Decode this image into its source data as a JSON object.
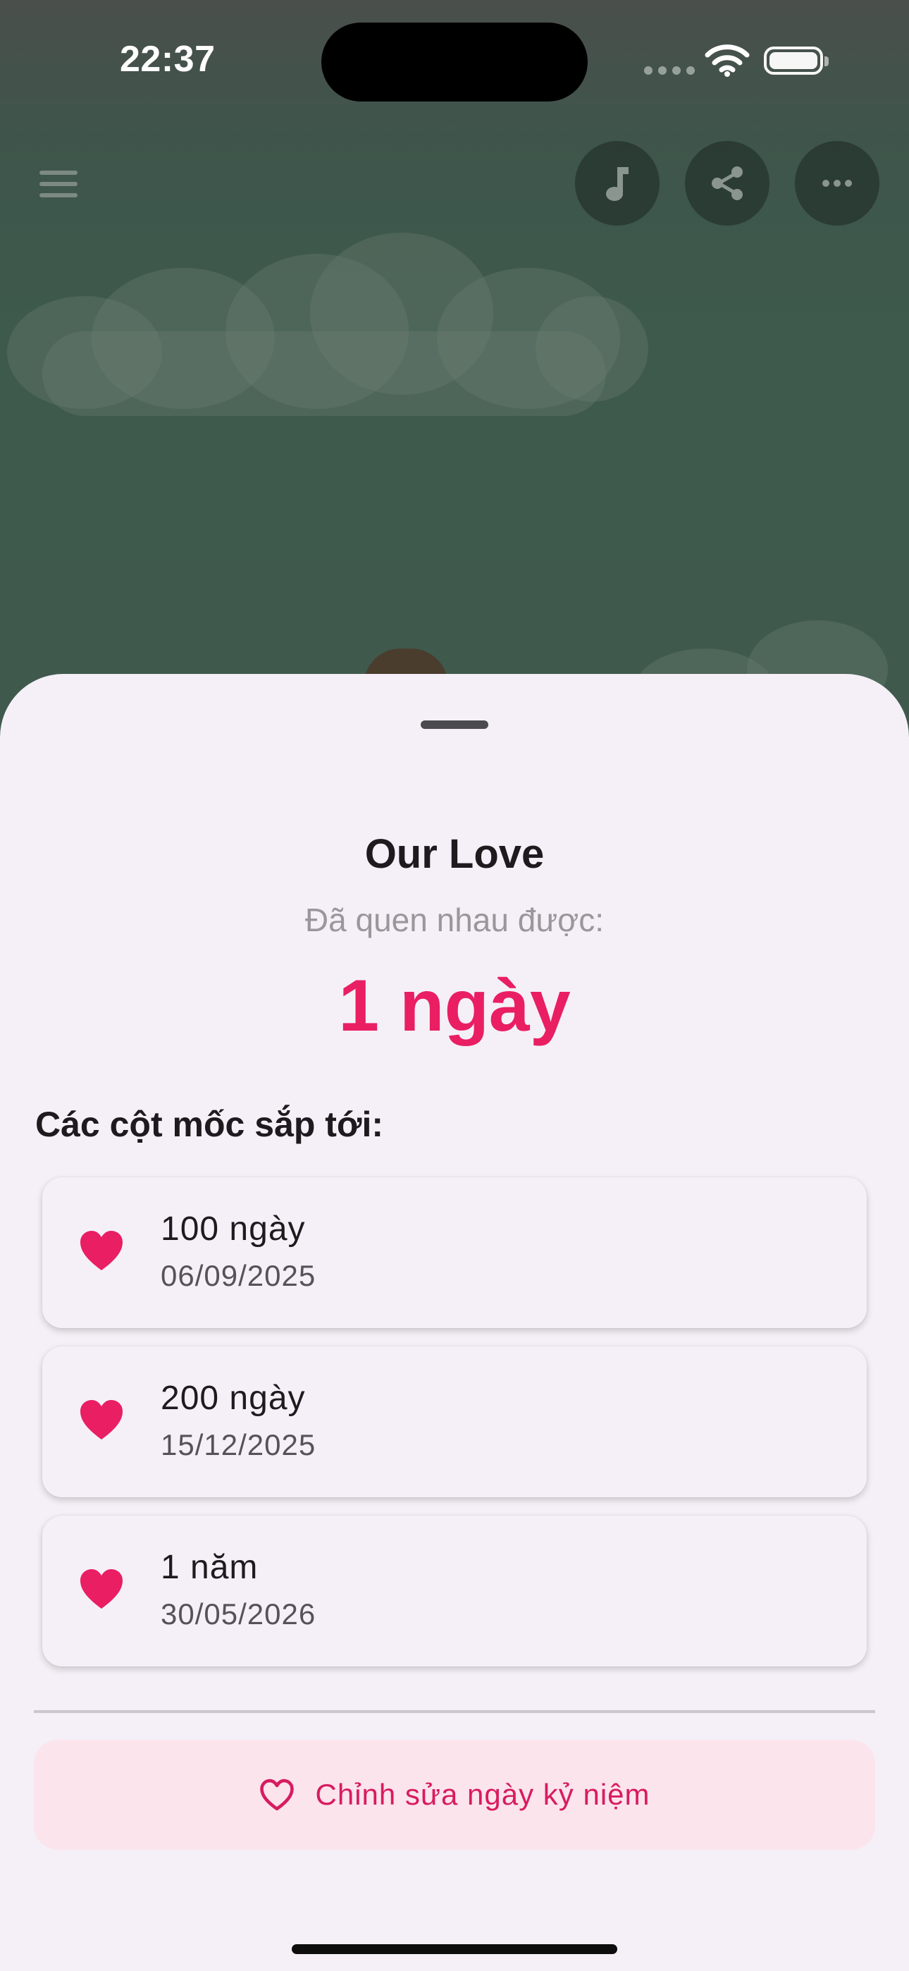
{
  "status_bar": {
    "time": "22:37"
  },
  "toolbar": {
    "menu_icon": "hamburger-icon",
    "music_icon": "music-note-icon",
    "share_icon": "share-icon",
    "more_icon": "more-horizontal-icon"
  },
  "sheet": {
    "title": "Our Love",
    "subtitle": "Đã quen nhau được:",
    "counter": "1 ngày",
    "milestones_label": "Các cột mốc sắp tới:",
    "milestones": [
      {
        "title": "100 ngày",
        "date": "06/09/2025"
      },
      {
        "title": "200 ngày",
        "date": "15/12/2025"
      },
      {
        "title": "1 năm",
        "date": "30/05/2026"
      }
    ],
    "edit_button_label": "Chỉnh sửa ngày kỷ niệm"
  },
  "colors": {
    "accent": "#e91e63",
    "sheet_background": "#f5f0f7",
    "edit_button_background": "#fbe4ec"
  }
}
